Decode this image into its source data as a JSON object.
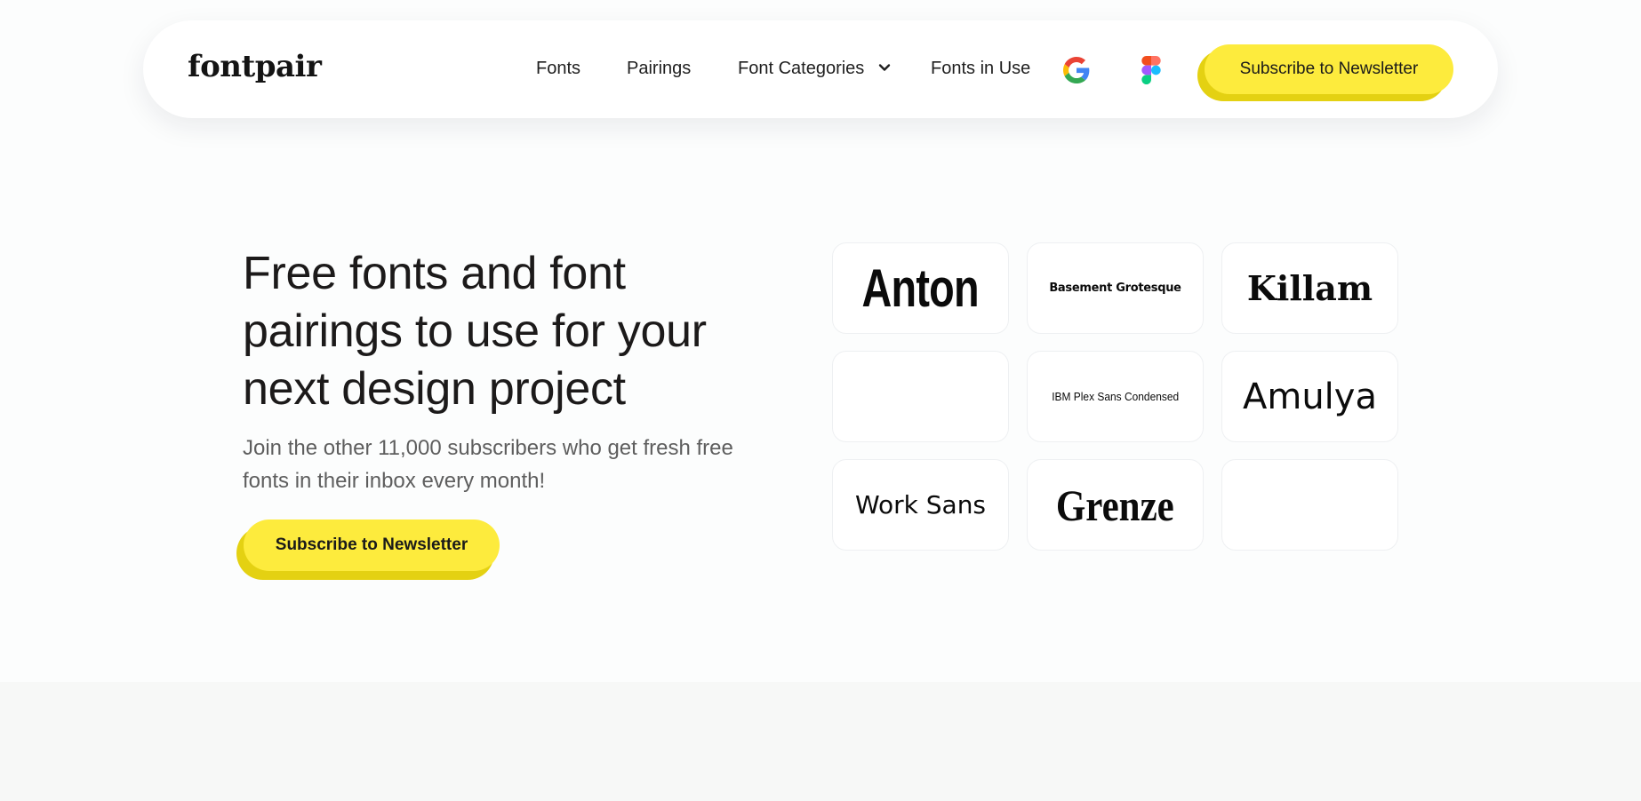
{
  "nav": {
    "logo": "fontpair",
    "links": [
      "Fonts",
      "Pairings",
      "Font Categories",
      "Fonts in Use"
    ],
    "google_icon": "google-icon",
    "figma_icon": "figma-icon",
    "dropdown_icon": "chevron-down-icon",
    "cta_label": "Subscribe to Newsletter"
  },
  "hero": {
    "title": "Free fonts and font pairings to use for your next design project",
    "subtitle": "Join the other 11,000 subscribers who get fresh free fonts in their inbox every month!",
    "cta_label": "Subscribe to Newsletter"
  },
  "font_tiles": [
    "Anton",
    "Basement Grotesque",
    "Killam",
    "",
    "IBM Plex Sans Condensed",
    "Amulya",
    "Work Sans",
    "Grenze",
    ""
  ],
  "colors": {
    "accent": "#fdeb3d",
    "accent_shadow": "#e4d112",
    "page_bg": "#fcfdfd",
    "text": "#1c1a1a",
    "muted_text": "#5e5e5e"
  }
}
